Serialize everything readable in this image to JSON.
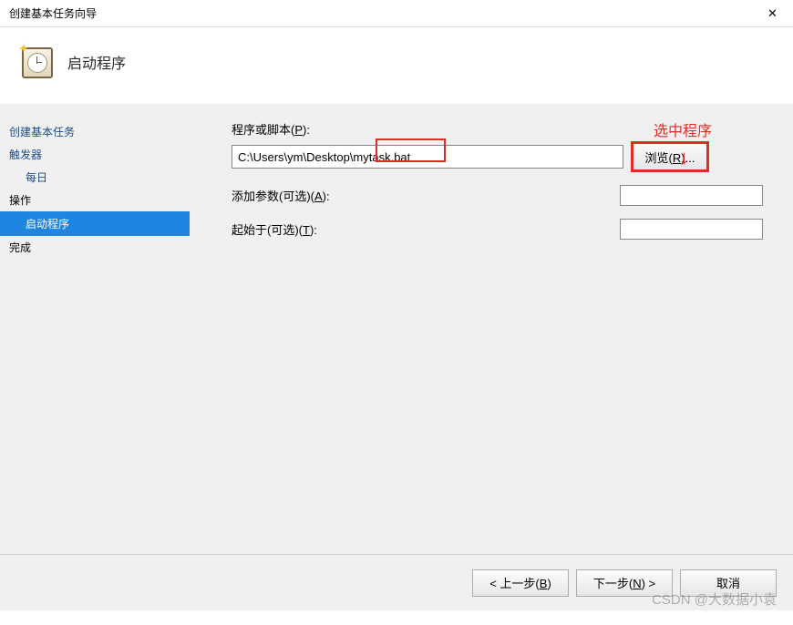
{
  "titlebar": {
    "title": "创建基本任务向导",
    "close_icon": "✕"
  },
  "header": {
    "title": "启动程序"
  },
  "sidebar": {
    "create_task": "创建基本任务",
    "trigger": "触发器",
    "trigger_daily": "每日",
    "action": "操作",
    "action_start": "启动程序",
    "finish": "完成"
  },
  "form": {
    "script_label_pre": "程序或脚本(",
    "script_label_key": "P",
    "script_label_post": "):",
    "script_value": "C:\\Users\\ym\\Desktop\\mytask.bat",
    "browse_pre": "浏览(",
    "browse_key": "R",
    "browse_post": ")...",
    "args_label_pre": "添加参数(可选)(",
    "args_label_key": "A",
    "args_label_post": "):",
    "args_value": "",
    "startin_label_pre": "起始于(可选)(",
    "startin_label_key": "T",
    "startin_label_post": "):",
    "startin_value": ""
  },
  "footer": {
    "back_pre": "< 上一步(",
    "back_key": "B",
    "back_post": ")",
    "next_pre": "下一步(",
    "next_key": "N",
    "next_post": ") >",
    "cancel": "取消"
  },
  "annotations": {
    "select_program": "选中程序",
    "arrow": "↓"
  },
  "watermark": "CSDN @大数据小袁"
}
